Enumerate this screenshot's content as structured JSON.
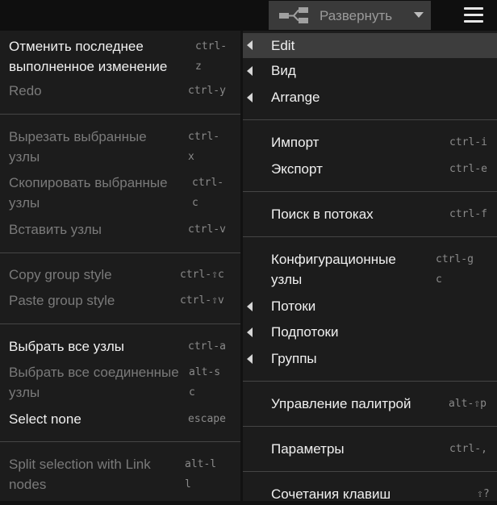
{
  "toolbar": {
    "deploy_label": "Развернуть"
  },
  "edit_menu": {
    "items": [
      {
        "label_line1": "Отменить последнее",
        "label_line2": "выполненное изменение",
        "key_line1": "ctrl-",
        "key_line2": "z"
      },
      {
        "label": "Redo",
        "key": "ctrl-y"
      },
      {
        "label_line1": "Вырезать выбранные",
        "label_line2": "узлы",
        "key_line1": "ctrl-",
        "key_line2": "x"
      },
      {
        "label_line1": "Скопировать выбранные",
        "label_line2": "узлы",
        "key_line1": "ctrl-",
        "key_line2": "c"
      },
      {
        "label": "Вставить узлы",
        "key": "ctrl-v"
      },
      {
        "label": "Copy group style",
        "key": "ctrl-⇧c"
      },
      {
        "label": "Paste group style",
        "key": "ctrl-⇧v"
      },
      {
        "label": "Выбрать все узлы",
        "key": "ctrl-a"
      },
      {
        "label_line1": "Выбрать все соединенные",
        "label_line2": "узлы",
        "key_line1": "alt-s",
        "key_line2": "c"
      },
      {
        "label": "Select none",
        "key": "escape"
      },
      {
        "label_line1": "Split selection with Link",
        "label_line2": "nodes",
        "key_line1": "alt-l",
        "key_line2": "l"
      }
    ]
  },
  "main_menu": {
    "items": [
      {
        "label": "Edit"
      },
      {
        "label": "Вид"
      },
      {
        "label": "Arrange"
      },
      {
        "label": "Импорт",
        "key": "ctrl-i"
      },
      {
        "label": "Экспорт",
        "key": "ctrl-e"
      },
      {
        "label": "Поиск в потоках",
        "key": "ctrl-f"
      },
      {
        "label_line1": "Конфигурационные",
        "label_line2": "узлы",
        "key_line1": "ctrl-g",
        "key_line2": "c"
      },
      {
        "label": "Потоки"
      },
      {
        "label": "Подпотоки"
      },
      {
        "label": "Группы"
      },
      {
        "label": "Управление палитрой",
        "key": "alt-⇧p"
      },
      {
        "label": "Параметры",
        "key": "ctrl-,"
      },
      {
        "label": "Сочетания клавиш",
        "key": "⇧?"
      }
    ]
  }
}
